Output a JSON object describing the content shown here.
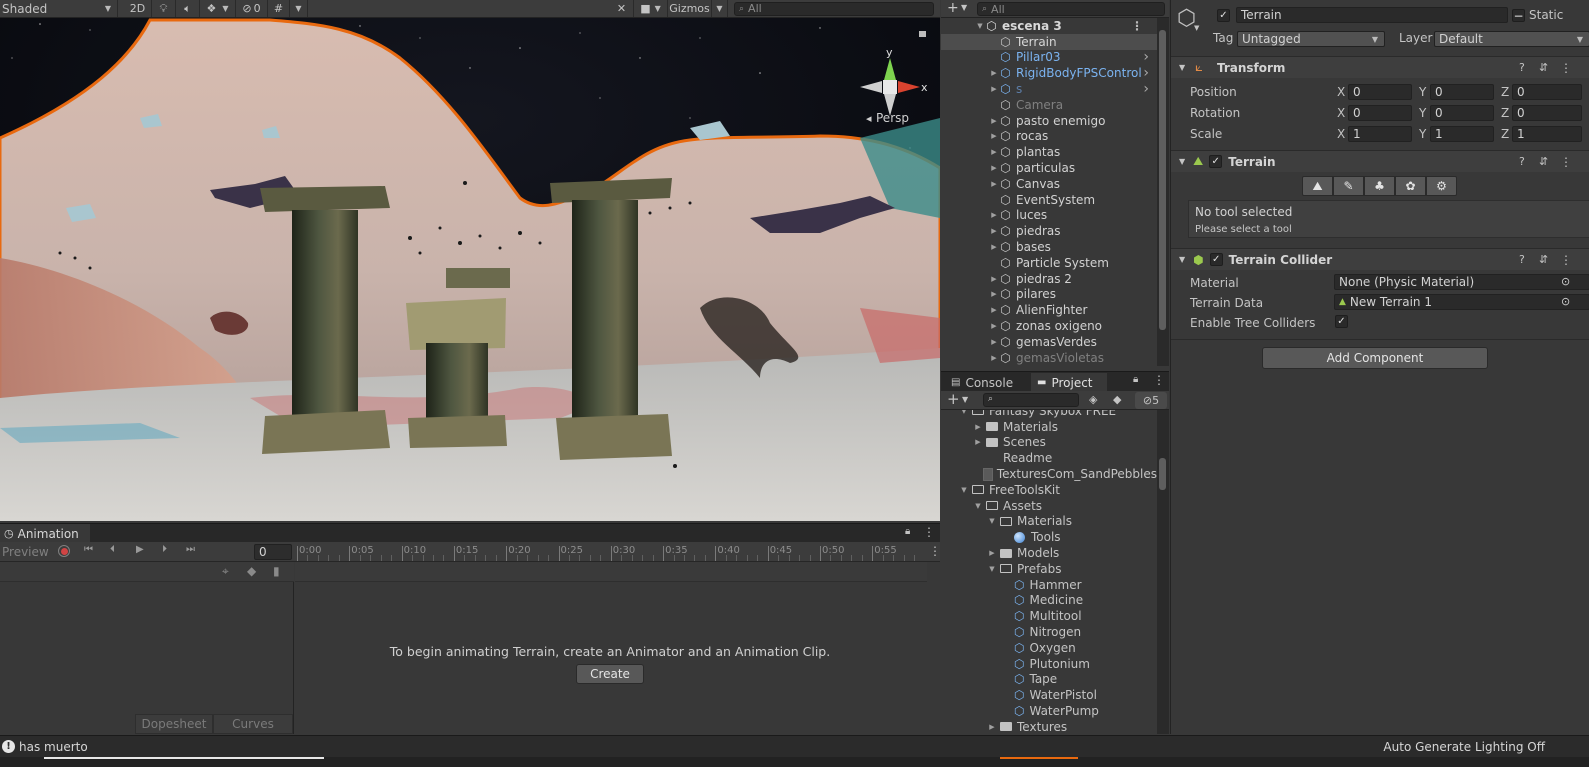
{
  "scene_toolbar": {
    "shading_mode": "Shaded",
    "btn_2d": "2D",
    "hidden_count": "0",
    "gizmos": "Gizmos",
    "search_placeholder": "All"
  },
  "scene_view": {
    "orientation_labels": {
      "y": "y",
      "x": "x"
    },
    "projection": "Persp"
  },
  "hierarchy": {
    "search_placeholder": "All",
    "scene_name": "escena 3",
    "items": [
      {
        "label": "Terrain",
        "selected": true,
        "expandable": false,
        "color": "#d8d8d8"
      },
      {
        "label": "Pillar03",
        "expandable": false,
        "color": "#7bb3f0",
        "prefab": true
      },
      {
        "label": "RigidBodyFPSControl",
        "expandable": true,
        "color": "#7bb3f0",
        "prefab": true
      },
      {
        "label": "s",
        "expandable": true,
        "color": "#5d7ea8",
        "prefab": true
      },
      {
        "label": "Camera",
        "expandable": false,
        "color": "#808080"
      },
      {
        "label": "pasto enemigo",
        "expandable": true,
        "color": "#d2d2d2"
      },
      {
        "label": "rocas",
        "expandable": true,
        "color": "#d2d2d2"
      },
      {
        "label": "plantas",
        "expandable": true,
        "color": "#d2d2d2"
      },
      {
        "label": "particulas",
        "expandable": true,
        "color": "#d2d2d2"
      },
      {
        "label": "Canvas",
        "expandable": true,
        "color": "#d2d2d2"
      },
      {
        "label": "EventSystem",
        "expandable": false,
        "color": "#d2d2d2"
      },
      {
        "label": "luces",
        "expandable": true,
        "color": "#d2d2d2"
      },
      {
        "label": "piedras",
        "expandable": true,
        "color": "#d2d2d2"
      },
      {
        "label": "bases",
        "expandable": true,
        "color": "#d2d2d2"
      },
      {
        "label": "Particle System",
        "expandable": false,
        "color": "#d2d2d2"
      },
      {
        "label": "piedras 2",
        "expandable": true,
        "color": "#d2d2d2"
      },
      {
        "label": "pilares",
        "expandable": true,
        "color": "#d2d2d2"
      },
      {
        "label": "AlienFighter",
        "expandable": true,
        "color": "#d2d2d2"
      },
      {
        "label": "zonas oxigeno",
        "expandable": true,
        "color": "#d2d2d2"
      },
      {
        "label": "gemasVerdes",
        "expandable": true,
        "color": "#d2d2d2"
      },
      {
        "label": "gemasVioletas",
        "expandable": true,
        "color": "#808080"
      }
    ]
  },
  "project": {
    "tabs": [
      "Console",
      "Project"
    ],
    "hidden_packages_count": "5",
    "items": [
      {
        "label": "Fantasy Skybox FREE",
        "kind": "folder-open",
        "depth": 0,
        "arrow": "down"
      },
      {
        "label": "Materials",
        "kind": "folder",
        "depth": 1,
        "arrow": "right"
      },
      {
        "label": "Scenes",
        "kind": "folder",
        "depth": 1,
        "arrow": "right"
      },
      {
        "label": "Readme",
        "kind": "file",
        "depth": 1,
        "arrow": ""
      },
      {
        "label": "TexturesCom_SandPebbles",
        "kind": "texture",
        "depth": 1,
        "arrow": ""
      },
      {
        "label": "FreeToolsKit",
        "kind": "folder-open",
        "depth": 0,
        "arrow": "down"
      },
      {
        "label": "Assets",
        "kind": "folder-open",
        "depth": 1,
        "arrow": "down"
      },
      {
        "label": "Materials",
        "kind": "folder-open",
        "depth": 2,
        "arrow": "down"
      },
      {
        "label": "Tools",
        "kind": "material",
        "depth": 3,
        "arrow": ""
      },
      {
        "label": "Models",
        "kind": "folder",
        "depth": 2,
        "arrow": "right"
      },
      {
        "label": "Prefabs",
        "kind": "folder-open",
        "depth": 2,
        "arrow": "down"
      },
      {
        "label": "Hammer",
        "kind": "prefab",
        "depth": 3,
        "arrow": ""
      },
      {
        "label": "Medicine",
        "kind": "prefab",
        "depth": 3,
        "arrow": ""
      },
      {
        "label": "Multitool",
        "kind": "prefab",
        "depth": 3,
        "arrow": ""
      },
      {
        "label": "Nitrogen",
        "kind": "prefab",
        "depth": 3,
        "arrow": ""
      },
      {
        "label": "Oxygen",
        "kind": "prefab",
        "depth": 3,
        "arrow": ""
      },
      {
        "label": "Plutonium",
        "kind": "prefab",
        "depth": 3,
        "arrow": ""
      },
      {
        "label": "Tape",
        "kind": "prefab",
        "depth": 3,
        "arrow": ""
      },
      {
        "label": "WaterPistol",
        "kind": "prefab",
        "depth": 3,
        "arrow": ""
      },
      {
        "label": "WaterPump",
        "kind": "prefab",
        "depth": 3,
        "arrow": ""
      },
      {
        "label": "Textures",
        "kind": "folder",
        "depth": 2,
        "arrow": "right"
      }
    ]
  },
  "inspector": {
    "object_name": "Terrain",
    "static_label": "Static",
    "tag_label": "Tag",
    "tag_value": "Untagged",
    "layer_label": "Layer",
    "layer_value": "Default",
    "transform": {
      "title": "Transform",
      "rows": [
        {
          "label": "Position",
          "x": "0",
          "y": "0",
          "z": "0"
        },
        {
          "label": "Rotation",
          "x": "0",
          "y": "0",
          "z": "0"
        },
        {
          "label": "Scale",
          "x": "1",
          "y": "1",
          "z": "1"
        }
      ],
      "axis_labels": [
        "X",
        "Y",
        "Z"
      ]
    },
    "terrain": {
      "title": "Terrain",
      "help_title": "No tool selected",
      "help_sub": "Please select a tool"
    },
    "collider": {
      "title": "Terrain Collider",
      "material_label": "Material",
      "material_value": "None (Physic Material)",
      "data_label": "Terrain Data",
      "data_value": "New Terrain 1",
      "trees_label": "Enable Tree Colliders"
    },
    "add_component": "Add Component"
  },
  "animation": {
    "tab": "Animation",
    "preview": "Preview",
    "frame": "0",
    "ticks": [
      "0:00",
      "0:05",
      "0:10",
      "0:15",
      "0:20",
      "0:25",
      "0:30",
      "0:35",
      "0:40",
      "0:45",
      "0:50",
      "0:55"
    ],
    "message": "To begin animating Terrain, create an Animator and an Animation Clip.",
    "create": "Create",
    "dopesheet": "Dopesheet",
    "curves": "Curves"
  },
  "status": {
    "message": "has muerto",
    "lighting": "Auto Generate Lighting Off"
  },
  "colors": {
    "selection_outline": "#e8690f",
    "prefab_blue": "#7bb3f0",
    "record_red": "#d04444"
  }
}
